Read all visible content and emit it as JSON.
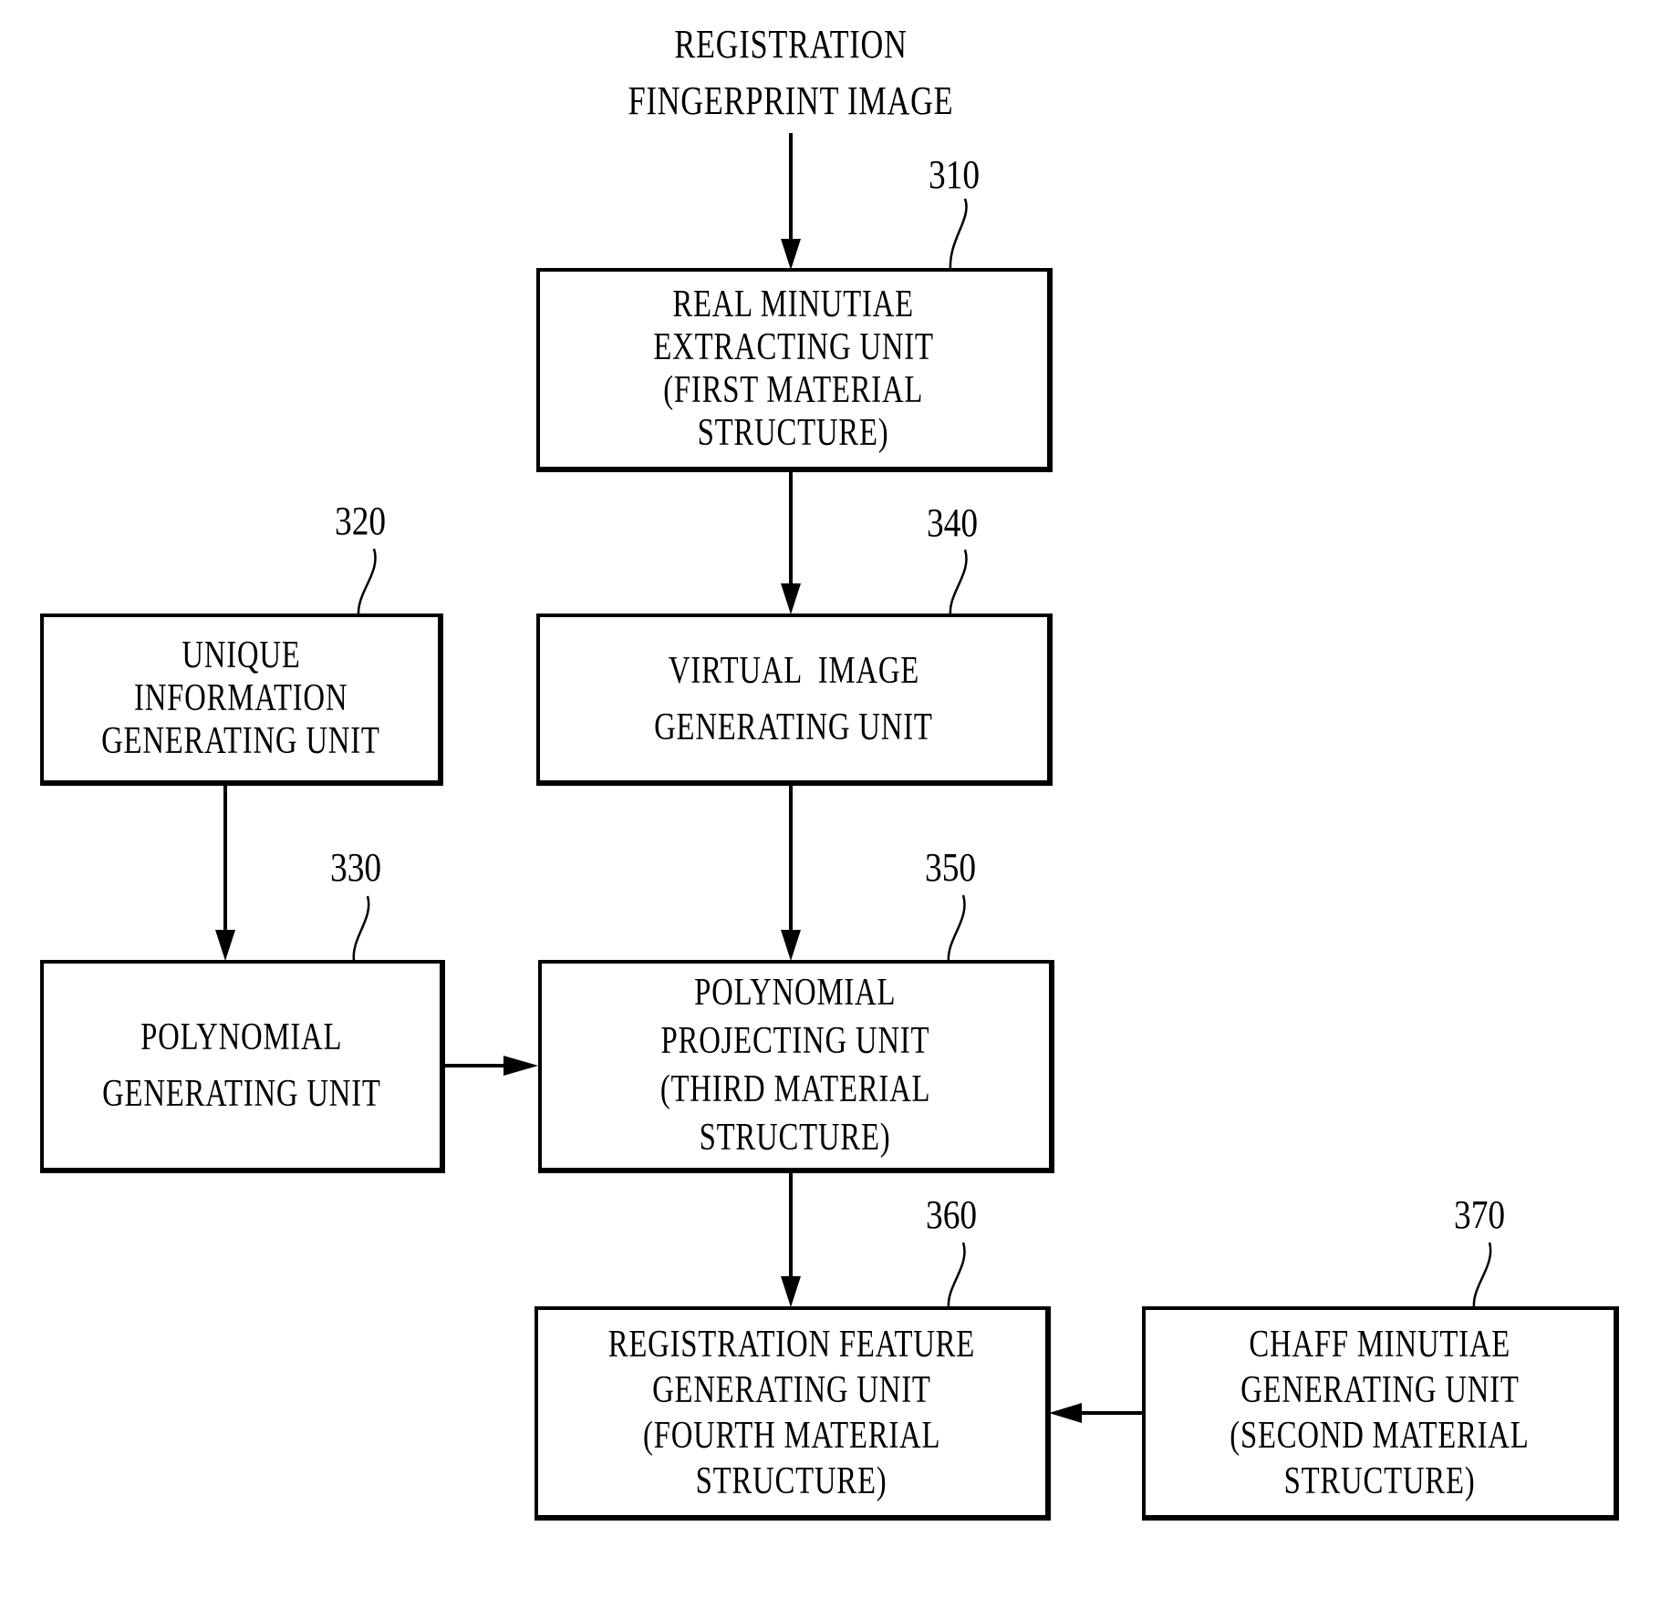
{
  "input_label": [
    "REGISTRATION",
    "FINGERPRINT IMAGE"
  ],
  "blocks": [
    {
      "id": "310",
      "ref": "310",
      "lines": [
        "REAL MINUTIAE",
        "EXTRACTING UNIT",
        "(FIRST MATERIAL",
        "STRUCTURE)"
      ]
    },
    {
      "id": "320",
      "ref": "320",
      "lines": [
        "UNIQUE",
        "INFORMATION",
        "GENERATING UNIT"
      ]
    },
    {
      "id": "330",
      "ref": "330",
      "lines": [
        "POLYNOMIAL",
        "GENERATING UNIT"
      ]
    },
    {
      "id": "340",
      "ref": "340",
      "lines": [
        "VIRTUAL  IMAGE",
        "GENERATING UNIT"
      ]
    },
    {
      "id": "350",
      "ref": "350",
      "lines": [
        "POLYNOMIAL",
        "PROJECTING UNIT",
        "(THIRD MATERIAL",
        "STRUCTURE)"
      ]
    },
    {
      "id": "360",
      "ref": "360",
      "lines": [
        "REGISTRATION FEATURE",
        "GENERATING UNIT",
        "(FOURTH MATERIAL",
        "STRUCTURE)"
      ]
    },
    {
      "id": "370",
      "ref": "370",
      "lines": [
        "CHAFF MINUTIAE",
        "GENERATING UNIT",
        "(SECOND MATERIAL",
        "STRUCTURE)"
      ]
    }
  ],
  "connections": [
    {
      "from": "input",
      "to": "310"
    },
    {
      "from": "310",
      "to": "340"
    },
    {
      "from": "320",
      "to": "330"
    },
    {
      "from": "340",
      "to": "350"
    },
    {
      "from": "330",
      "to": "350"
    },
    {
      "from": "350",
      "to": "360"
    },
    {
      "from": "370",
      "to": "360"
    }
  ]
}
